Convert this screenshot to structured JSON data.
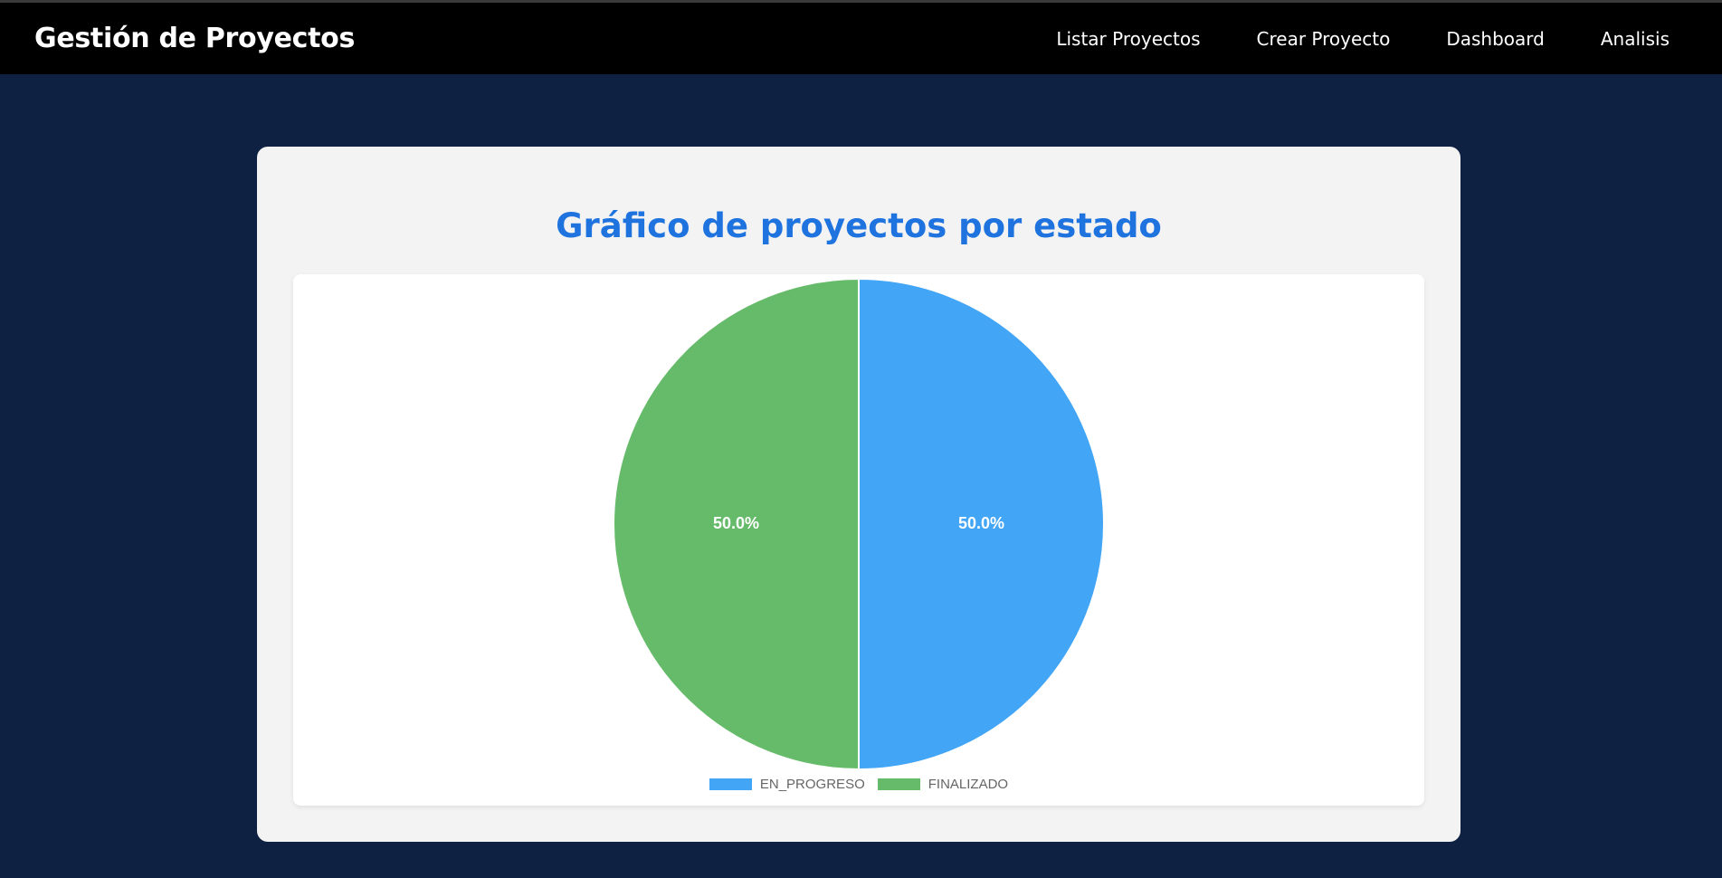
{
  "app": {
    "brand": "Gestión de Proyectos",
    "nav": [
      {
        "label": "Listar Proyectos"
      },
      {
        "label": "Crear Proyecto"
      },
      {
        "label": "Dashboard"
      },
      {
        "label": "Analisis"
      }
    ]
  },
  "card": {
    "title": "Gráfico de proyectos por estado"
  },
  "colors": {
    "navbar_bg": "#000000",
    "page_bg": "#0e2142",
    "title": "#1f73df",
    "en_progreso": "#42a5f5",
    "finalizado": "#66bb6a"
  },
  "chart_data": {
    "type": "pie",
    "title": "",
    "categories": [
      "EN_PROGRESO",
      "FINALIZADO"
    ],
    "values": [
      50,
      50
    ],
    "labels": [
      "50.0%",
      "50.0%"
    ],
    "colors": [
      "#42a5f5",
      "#66bb6a"
    ],
    "legend_position": "bottom"
  }
}
